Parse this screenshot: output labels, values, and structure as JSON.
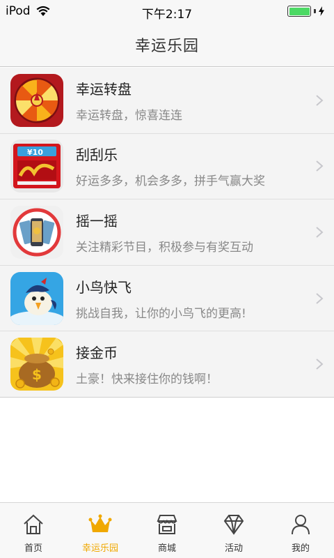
{
  "status_bar": {
    "carrier": "iPod",
    "time": "下午2:17"
  },
  "header": {
    "title": "幸运乐园"
  },
  "games": [
    {
      "title": "幸运转盘",
      "desc": "幸运转盘，惊喜连连",
      "icon": "wheel-icon"
    },
    {
      "title": "刮刮乐",
      "desc": "好运多多，机会多多，拼手气赢大奖",
      "icon": "scratch-card-icon"
    },
    {
      "title": "摇一摇",
      "desc": "关注精彩节目，积极参与有奖互动",
      "icon": "shake-phone-icon"
    },
    {
      "title": "小鸟快飞",
      "desc": "挑战自我，让你的小鸟飞的更高!",
      "icon": "bird-icon"
    },
    {
      "title": "接金币",
      "desc": "土豪！快来接住你的钱啊！",
      "icon": "gold-coins-icon"
    }
  ],
  "tabs": [
    {
      "label": "首页",
      "icon": "home-icon",
      "active": false
    },
    {
      "label": "幸运乐园",
      "icon": "crown-icon",
      "active": true
    },
    {
      "label": "商城",
      "icon": "shop-icon",
      "active": false
    },
    {
      "label": "活动",
      "icon": "diamond-icon",
      "active": false
    },
    {
      "label": "我的",
      "icon": "user-icon",
      "active": false
    }
  ],
  "colors": {
    "accent": "#f0a800",
    "battery": "#4cd964"
  }
}
